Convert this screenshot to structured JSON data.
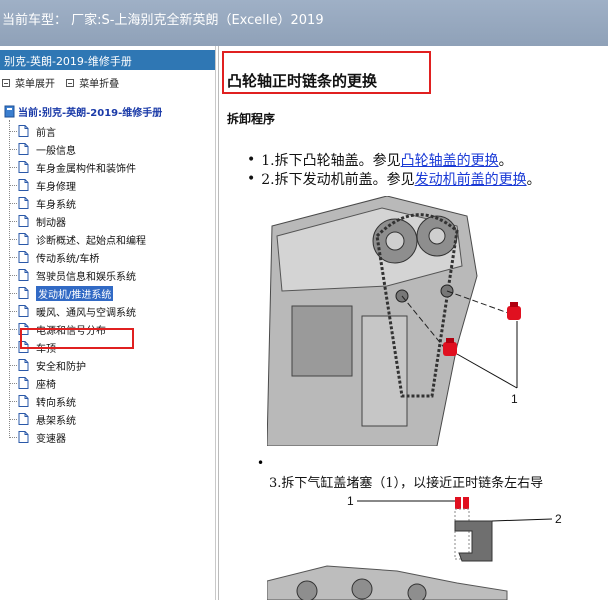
{
  "titlebar": {
    "text": "当前车型： 厂家:S-上海别克全新英朗（Excelle）2019"
  },
  "sidebar": {
    "header": "别克-英朗-2019-维修手册",
    "expand_label": "菜单展开",
    "collapse_label": "菜单折叠",
    "root_label": "当前:别克-英朗-2019-维修手册",
    "items": [
      {
        "label": "前言"
      },
      {
        "label": "一般信息"
      },
      {
        "label": "车身金属构件和装饰件"
      },
      {
        "label": "车身修理"
      },
      {
        "label": "车身系统"
      },
      {
        "label": "制动器"
      },
      {
        "label": "诊断概述、起始点和编程"
      },
      {
        "label": "传动系统/车桥"
      },
      {
        "label": "驾驶员信息和娱乐系统"
      },
      {
        "label": "发动机/推进系统"
      },
      {
        "label": "暖风、通风与空调系统"
      },
      {
        "label": "电源和信号分布"
      },
      {
        "label": "车顶"
      },
      {
        "label": "安全和防护"
      },
      {
        "label": "座椅"
      },
      {
        "label": "转向系统"
      },
      {
        "label": "悬架系统"
      },
      {
        "label": "变速器"
      }
    ],
    "selected_index": 9
  },
  "main": {
    "title": "凸轮轴正时链条的更换",
    "subheading": "拆卸程序",
    "step1_text": "1.拆下凸轮轴盖。参见",
    "step1_link": "凸轮轴盖的更换",
    "step1_end": "。",
    "step2_text": "2.拆下发动机前盖。参见",
    "step2_link": "发动机前盖的更换",
    "step2_end": "。",
    "fig1_callout": "1",
    "step3_text": "3.拆下气缸盖堵塞（1），以接近正时链条左右导",
    "fig2_callout1": "1",
    "fig2_callout2": "2",
    "bullet": "•"
  },
  "colors": {
    "titlebar": "#8fa1b8",
    "sidebar_header": "#2f77b4",
    "highlight": "#e02020",
    "link": "#1a3ad6"
  }
}
